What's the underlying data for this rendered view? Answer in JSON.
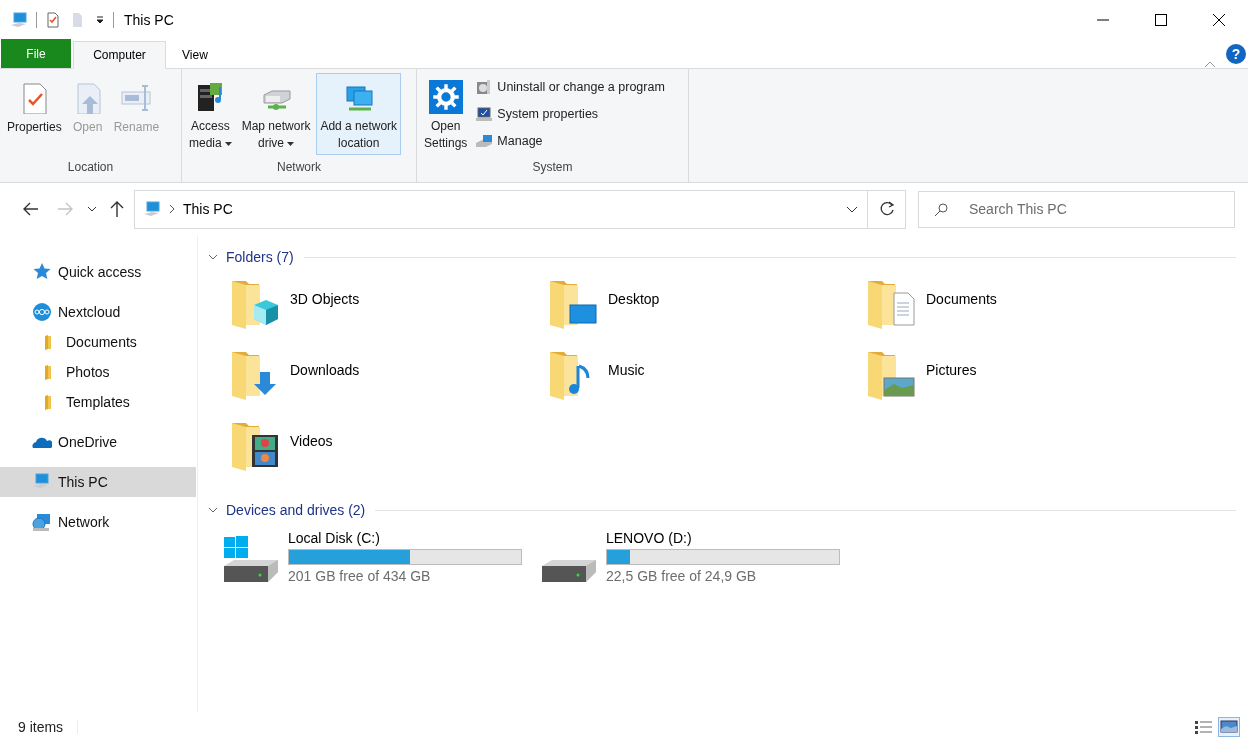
{
  "window": {
    "title": "This PC"
  },
  "ribbon": {
    "tabs": [
      {
        "label": "File",
        "kind": "file",
        "selected": false
      },
      {
        "label": "Computer",
        "kind": "tab",
        "selected": true
      },
      {
        "label": "View",
        "kind": "tab",
        "selected": false
      }
    ],
    "help": "?",
    "groups": [
      {
        "label": "Location",
        "commands": [
          {
            "kind": "large",
            "lines": [
              "Properties"
            ],
            "disabled": false
          },
          {
            "kind": "large",
            "lines": [
              "Open"
            ],
            "disabled": true
          },
          {
            "kind": "large",
            "lines": [
              "Rename"
            ],
            "disabled": true
          }
        ]
      },
      {
        "label": "Network",
        "commands": [
          {
            "kind": "large",
            "lines": [
              "Access",
              "media"
            ],
            "disabled": false,
            "dropdown": true
          },
          {
            "kind": "large",
            "lines": [
              "Map network",
              "drive"
            ],
            "disabled": false,
            "dropdown": true
          },
          {
            "kind": "large",
            "lines": [
              "Add a network",
              "location"
            ],
            "disabled": false,
            "highlighted": true
          }
        ]
      },
      {
        "label": "System",
        "commands": [
          {
            "kind": "large",
            "lines": [
              "Open",
              "Settings"
            ],
            "disabled": false
          },
          {
            "kind": "small",
            "lines": [
              "Uninstall or change a program"
            ],
            "disabled": false
          },
          {
            "kind": "small",
            "lines": [
              "System properties"
            ],
            "disabled": false
          },
          {
            "kind": "small",
            "lines": [
              "Manage"
            ],
            "disabled": false
          }
        ]
      }
    ]
  },
  "navigation": {
    "back": {
      "disabled": false
    },
    "forward": {
      "disabled": true
    },
    "address": {
      "path": [
        "This PC"
      ]
    },
    "search": {
      "placeholder": "Search This PC"
    }
  },
  "sidebar": {
    "items": [
      {
        "label": "Quick access",
        "selected": false
      },
      {
        "label": "Nextcloud",
        "selected": false,
        "children": [
          {
            "label": "Documents",
            "selected": false
          },
          {
            "label": "Photos",
            "selected": false
          },
          {
            "label": "Templates",
            "selected": false
          }
        ]
      },
      {
        "label": "OneDrive",
        "selected": false
      },
      {
        "label": "This PC",
        "selected": true
      },
      {
        "label": "Network",
        "selected": false
      }
    ]
  },
  "content": {
    "sections": [
      {
        "kind": "folders",
        "title": "Folders (7)",
        "expanded": true,
        "items": [
          {
            "name": "3D Objects"
          },
          {
            "name": "Desktop"
          },
          {
            "name": "Documents"
          },
          {
            "name": "Downloads"
          },
          {
            "name": "Music"
          },
          {
            "name": "Pictures"
          },
          {
            "name": "Videos"
          }
        ]
      },
      {
        "kind": "drives",
        "title": "Devices and drives (2)",
        "expanded": true,
        "items": [
          {
            "name": "Local Disk (C:)",
            "level": 0.52,
            "space": "201 GB free of 434 GB"
          },
          {
            "name": "LENOVO (D:)",
            "level": 0.1,
            "space": "22,5 GB free of 24,9 GB"
          }
        ]
      }
    ]
  },
  "status_bar": {
    "text": "9 items",
    "views": [
      {
        "kind": "details",
        "selected": false
      },
      {
        "kind": "large-icons",
        "selected": true
      }
    ]
  }
}
